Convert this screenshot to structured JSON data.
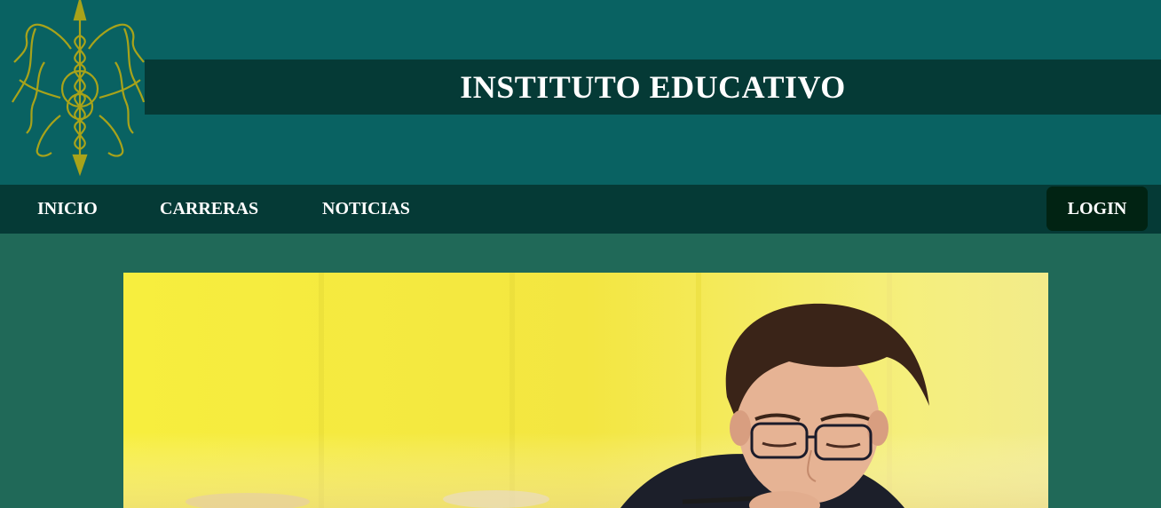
{
  "header": {
    "title": "INSTITUTO EDUCATIVO",
    "logo_icon": "crest-logo-icon"
  },
  "nav": {
    "items": [
      {
        "label": "INICIO"
      },
      {
        "label": "CARRERAS"
      },
      {
        "label": "NOTICIAS"
      }
    ],
    "login_label": "LOGIN"
  },
  "hero": {
    "image": "student-photo"
  },
  "colors": {
    "header_bg": "#096262",
    "band_bg": "#053a36",
    "page_bg": "#206958",
    "login_bg": "#012313",
    "logo": "#a8a31a",
    "hero_yellow": "#f6ee3a"
  }
}
